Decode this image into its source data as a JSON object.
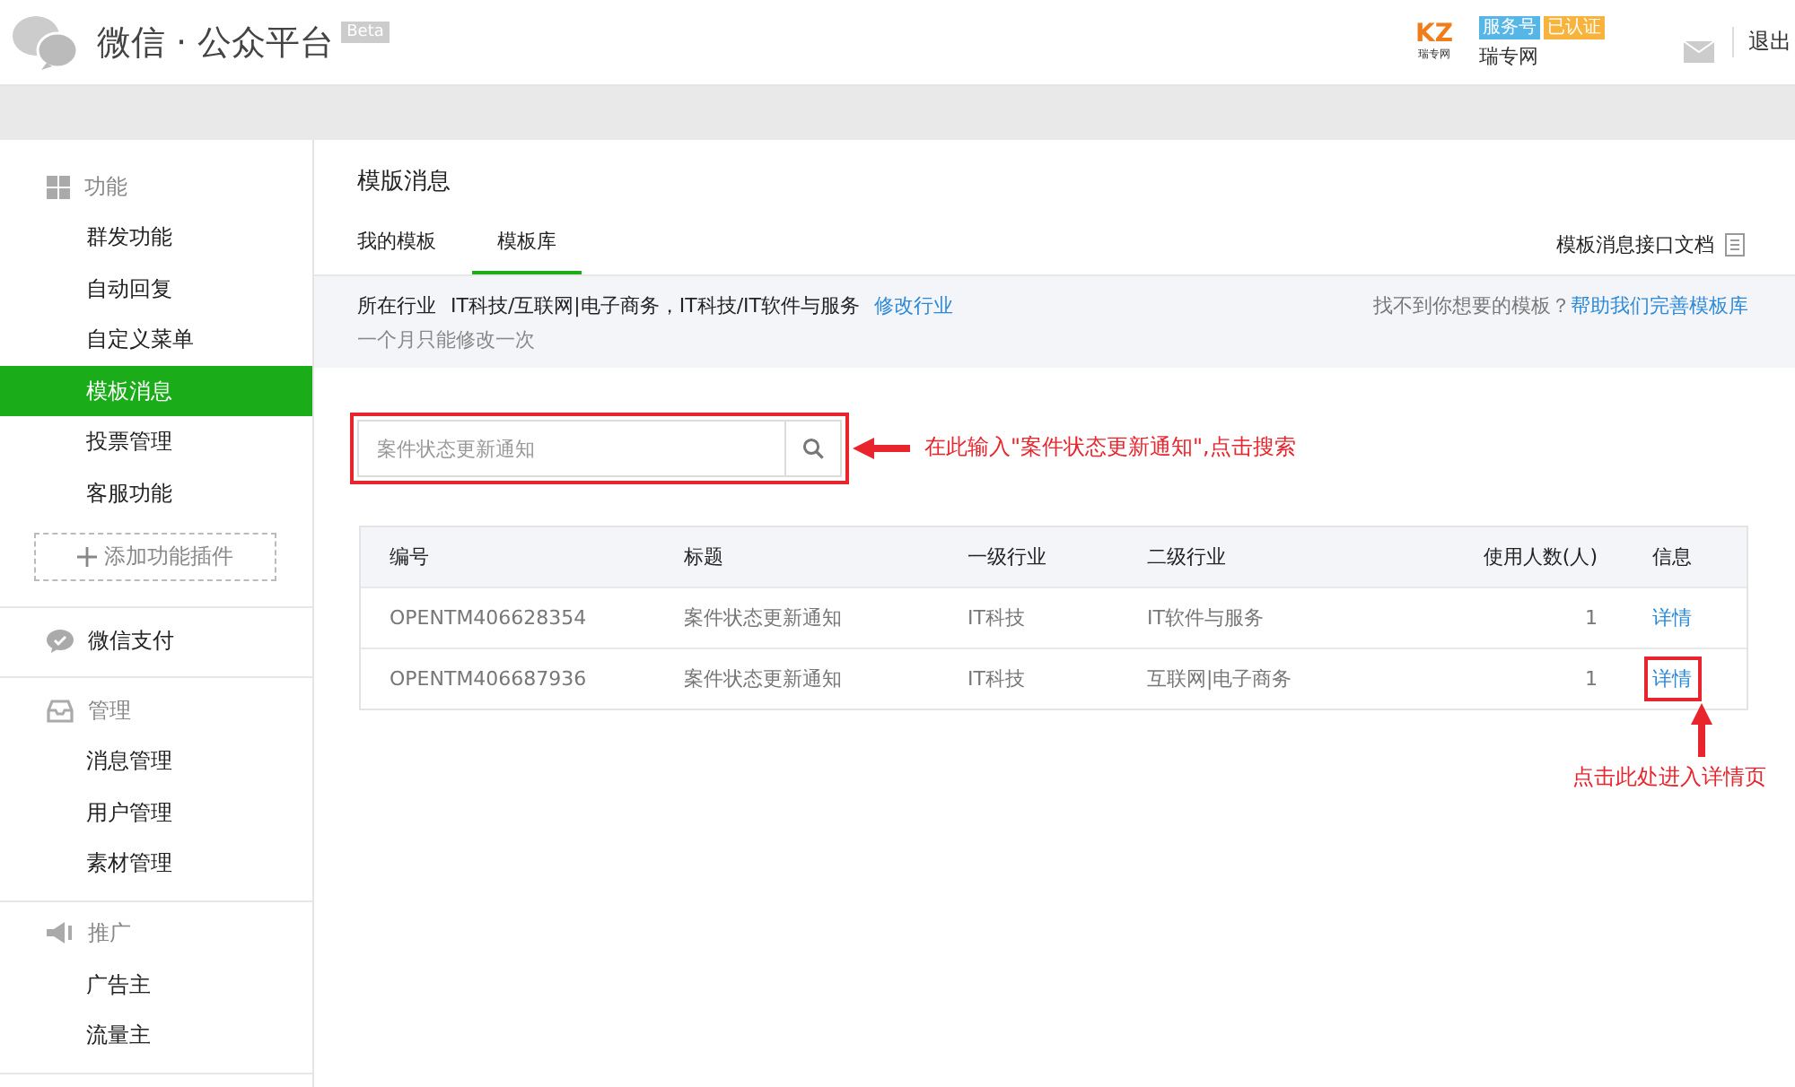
{
  "header": {
    "logo_text": "微信 · 公众平台",
    "beta": "Beta",
    "account_badges": [
      {
        "label": "服务号",
        "color": "#56b6e6"
      },
      {
        "label": "已认证",
        "color": "#f7b33b"
      }
    ],
    "account_logo": "KZ",
    "account_logo_sub": "瑞专网",
    "account_name": "瑞专网",
    "logout": "退出"
  },
  "sidebar": {
    "sections": [
      {
        "title": "功能",
        "items": [
          {
            "label": "群发功能",
            "selected": false
          },
          {
            "label": "自动回复",
            "selected": false
          },
          {
            "label": "自定义菜单",
            "selected": false
          },
          {
            "label": "模板消息",
            "selected": true
          },
          {
            "label": "投票管理",
            "selected": false
          },
          {
            "label": "客服功能",
            "selected": false
          }
        ],
        "add_button": "添加功能插件"
      },
      {
        "title": "微信支付"
      },
      {
        "title": "管理",
        "items": [
          {
            "label": "消息管理",
            "selected": false
          },
          {
            "label": "用户管理",
            "selected": false
          },
          {
            "label": "素材管理",
            "selected": false
          }
        ]
      },
      {
        "title": "推广",
        "items": [
          {
            "label": "广告主",
            "selected": false
          },
          {
            "label": "流量主",
            "selected": false
          }
        ]
      }
    ]
  },
  "main": {
    "title": "模版消息",
    "tabs": [
      {
        "label": "我的模板",
        "selected": false
      },
      {
        "label": "模板库",
        "selected": true
      }
    ],
    "doc_link": "模板消息接口文档",
    "industry": {
      "label": "所在行业",
      "value": "IT科技/互联网|电子商务，IT科技/IT软件与服务",
      "edit_link": "修改行业",
      "note": "一个月只能修改一次",
      "help_text": "找不到你想要的模板？",
      "help_link": "帮助我们完善模板库"
    },
    "search": {
      "placeholder": "案件状态更新通知"
    },
    "table": {
      "columns": [
        "编号",
        "标题",
        "一级行业",
        "二级行业",
        "使用人数(人)",
        "信息"
      ],
      "rows": [
        {
          "cells": [
            "OPENTM406628354",
            "案件状态更新通知",
            "IT科技",
            "IT软件与服务",
            "1"
          ],
          "link": "详情",
          "highlighted": false
        },
        {
          "cells": [
            "OPENTM406687936",
            "案件状态更新通知",
            "IT科技",
            "互联网|电子商务",
            "1"
          ],
          "link": "详情",
          "highlighted": true
        }
      ]
    }
  },
  "annotations": [
    "在此输入\"案件状态更新通知\",点击搜索",
    "点击此处进入详情页"
  ]
}
